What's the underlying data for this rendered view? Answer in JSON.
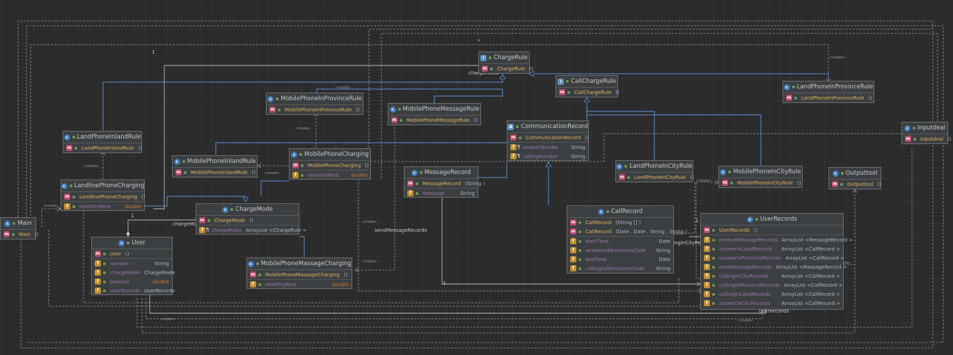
{
  "labels": {
    "charge_rules": "chargeRules",
    "charge_mode": "chargeMode",
    "send_message_records": "sendMessageRecords",
    "calling_in_city_records": "callingInCityRecords",
    "user_records": "userRecords",
    "one": "1",
    "star": "*",
    "create": "«create»"
  },
  "nodes": {
    "charge_rule": {
      "name": "ChargeRule",
      "methods": [
        {
          "name": "ChargeRule",
          "params": "()"
        }
      ]
    },
    "call_charge_rule": {
      "name": "CallChargeRule",
      "methods": [
        {
          "name": "CallChargeRule",
          "params": "()"
        }
      ]
    },
    "land_phone_in_province_rule": {
      "name": "LandPhoneInProvinceRule",
      "methods": [
        {
          "name": "LandPhoneInProvinceRule",
          "params": "()"
        }
      ]
    },
    "mobile_phone_in_province_rule": {
      "name": "MobilePhoneInProvinceRule",
      "methods": [
        {
          "name": "MobilePhoneInProvinceRule",
          "params": "()"
        }
      ]
    },
    "mobile_phone_message_rule": {
      "name": "MobilePhoneMessageRule",
      "methods": [
        {
          "name": "MobilePhoneMessageRule",
          "params": "()"
        }
      ]
    },
    "land_phone_inland_rule": {
      "name": "LandPhoneInlandRule",
      "methods": [
        {
          "name": "LandPhoneInlandRule",
          "params": "()"
        }
      ]
    },
    "communication_record": {
      "name": "CommunicationRecord",
      "methods": [
        {
          "name": "CommunicationRecord",
          "params": "()"
        }
      ],
      "fields": [
        {
          "name": "answerNumbe",
          "type": "String"
        },
        {
          "name": "callingNumber",
          "type": "String"
        }
      ]
    },
    "input_deal": {
      "name": "Inputdeal",
      "methods": [
        {
          "name": "Inputdeal",
          "params": "()"
        }
      ]
    },
    "mobile_phone_inland_rule": {
      "name": "MobilePhoneInlandRule",
      "methods": [
        {
          "name": "MobilePhoneInlandRule",
          "params": "()"
        }
      ]
    },
    "mobile_phone_charging": {
      "name": "MobilePhoneCharging",
      "methods": [
        {
          "name": "MobilePhoneCharging",
          "params": "()"
        }
      ],
      "fields": [
        {
          "name": "monthlyRent",
          "type": "double"
        }
      ]
    },
    "message_record": {
      "name": "MessageRecord",
      "methods": [
        {
          "name": "MessageRecord",
          "params": "(String )"
        }
      ],
      "fields": [
        {
          "name": "message",
          "type": "String"
        }
      ]
    },
    "land_phone_in_city_rule": {
      "name": "LandPhoneInCityRule",
      "methods": [
        {
          "name": "LandPhoneInCityRule",
          "params": "()"
        }
      ]
    },
    "mobile_phone_in_city_rule": {
      "name": "MobilePhoneInCityRule",
      "methods": [
        {
          "name": "MobilePhoneInCityRule",
          "params": "()"
        }
      ]
    },
    "output_tool": {
      "name": "Outputtool",
      "methods": [
        {
          "name": "Outputtool",
          "params": "()"
        }
      ]
    },
    "landline_phone_charging": {
      "name": "LandlinePhoneCharging",
      "methods": [
        {
          "name": "LandlinePhoneCharging",
          "params": "()"
        }
      ],
      "fields": [
        {
          "name": "monthlyRent",
          "type": "double"
        }
      ]
    },
    "main": {
      "name": "Main",
      "methods": [
        {
          "name": "Main",
          "params": "()"
        }
      ]
    },
    "charge_mode": {
      "name": "ChargeMode",
      "methods": [
        {
          "name": "ChargeMode",
          "params": "()"
        }
      ],
      "fields": [
        {
          "name": "chargeRules",
          "type": "ArrayList  <ChargeRule >"
        }
      ]
    },
    "call_record": {
      "name": "CallRecord",
      "methods": [
        {
          "name": "CallRecord",
          "params": "(String [] )"
        },
        {
          "name": "CallRecord",
          "params": "(Date , Date , String , String )"
        }
      ],
      "fields": [
        {
          "name": "startTime",
          "type": "Date"
        },
        {
          "name": "answerAddressAreaCode",
          "type": "String"
        },
        {
          "name": "endTime",
          "type": "Date"
        },
        {
          "name": "callingAddressAreaCode",
          "type": "String"
        }
      ]
    },
    "user_records": {
      "name": "UserRecords",
      "methods": [
        {
          "name": "UserRecords",
          "params": "()"
        }
      ],
      "fields": [
        {
          "name": "receiveMessageRecords",
          "type": "ArrayList  <MessageRecord  >"
        },
        {
          "name": "answerInLandRecords",
          "type": "ArrayList  <CallRecord  >"
        },
        {
          "name": "answerInProvinceRecords",
          "type": "ArrayList  <CallRecord  >"
        },
        {
          "name": "sendMessageRecords",
          "type": "ArrayList  <MessageRecord  >"
        },
        {
          "name": "callingInCityRecords",
          "type": "ArrayList  <CallRecord  >"
        },
        {
          "name": "callingInProvinceRecords",
          "type": "ArrayList  <CallRecord  >"
        },
        {
          "name": "callingInLandRecords",
          "type": "ArrayList  <CallRecord  >"
        },
        {
          "name": "answerInCityRecords",
          "type": "ArrayList  <CallRecord  >"
        }
      ]
    },
    "user": {
      "name": "User",
      "methods": [
        {
          "name": "User",
          "params": "()"
        }
      ],
      "fields": [
        {
          "name": "number",
          "type": "String"
        },
        {
          "name": "chargeMode",
          "type": "ChargeMode"
        },
        {
          "name": "balance",
          "type": "double"
        },
        {
          "name": "userRecords",
          "type": "UserRecords"
        }
      ]
    },
    "mobile_phone_massage_charging": {
      "name": "MobilePhoneMassageCharging",
      "methods": [
        {
          "name": "MobilePhoneMassageCharging",
          "params": "()"
        }
      ],
      "fields": [
        {
          "name": "monthlyRent",
          "type": "double"
        }
      ]
    }
  },
  "colors": {
    "background": "#2b2b2b",
    "inheritance": "#5c8fd6",
    "dependency": "#9a9a9a",
    "method_name": "#e0b45e",
    "field_name": "#9876aa"
  }
}
